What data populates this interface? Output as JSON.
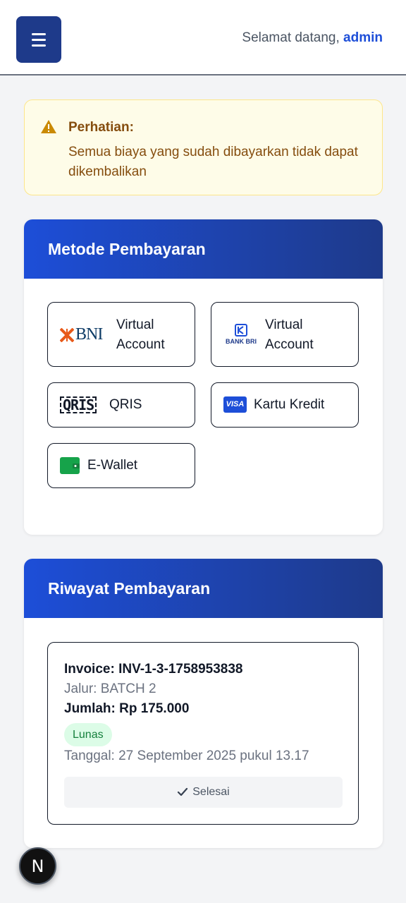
{
  "header": {
    "menu_icon": "hamburger-icon",
    "greeting": "Selamat datang,",
    "username": "admin"
  },
  "alert": {
    "icon": "warning-icon",
    "title": "Perhatian:",
    "message": "Semua biaya yang sudah dibayarkan tidak dapat dikembalikan",
    "color": "#854d0e"
  },
  "payment_methods": {
    "title": "Metode Pembayaran",
    "items": [
      {
        "logo": "BNI",
        "logo_icon": "bni-logo",
        "label": "Virtual Account"
      },
      {
        "logo": "BANK BRI",
        "logo_icon": "bri-logo",
        "label": "Virtual Account"
      },
      {
        "logo": "QRIS",
        "logo_icon": "qris-logo",
        "label": "QRIS"
      },
      {
        "logo": "VISA",
        "logo_icon": "visa-card-icon",
        "label": "Kartu Kredit"
      },
      {
        "logo": "",
        "logo_icon": "wallet-icon",
        "label": "E-Wallet"
      }
    ]
  },
  "history": {
    "title": "Riwayat Pembayaran",
    "entries": [
      {
        "invoice": "Invoice: INV-1-3-1758953838",
        "jalur": "Jalur: BATCH 2",
        "jumlah": "Jumlah: Rp 175.000",
        "status": "Lunas",
        "tanggal": "Tanggal: 27 September 2025 pukul 13.17",
        "action": "Selesai",
        "action_icon": "check-icon"
      }
    ]
  },
  "dev_button": {
    "label": "N",
    "icon": "nextjs-icon"
  },
  "colors": {
    "primary": "#1e3a8a",
    "accent": "#1d4ed8",
    "success": "#15803d",
    "warning": "#ca8a04"
  }
}
